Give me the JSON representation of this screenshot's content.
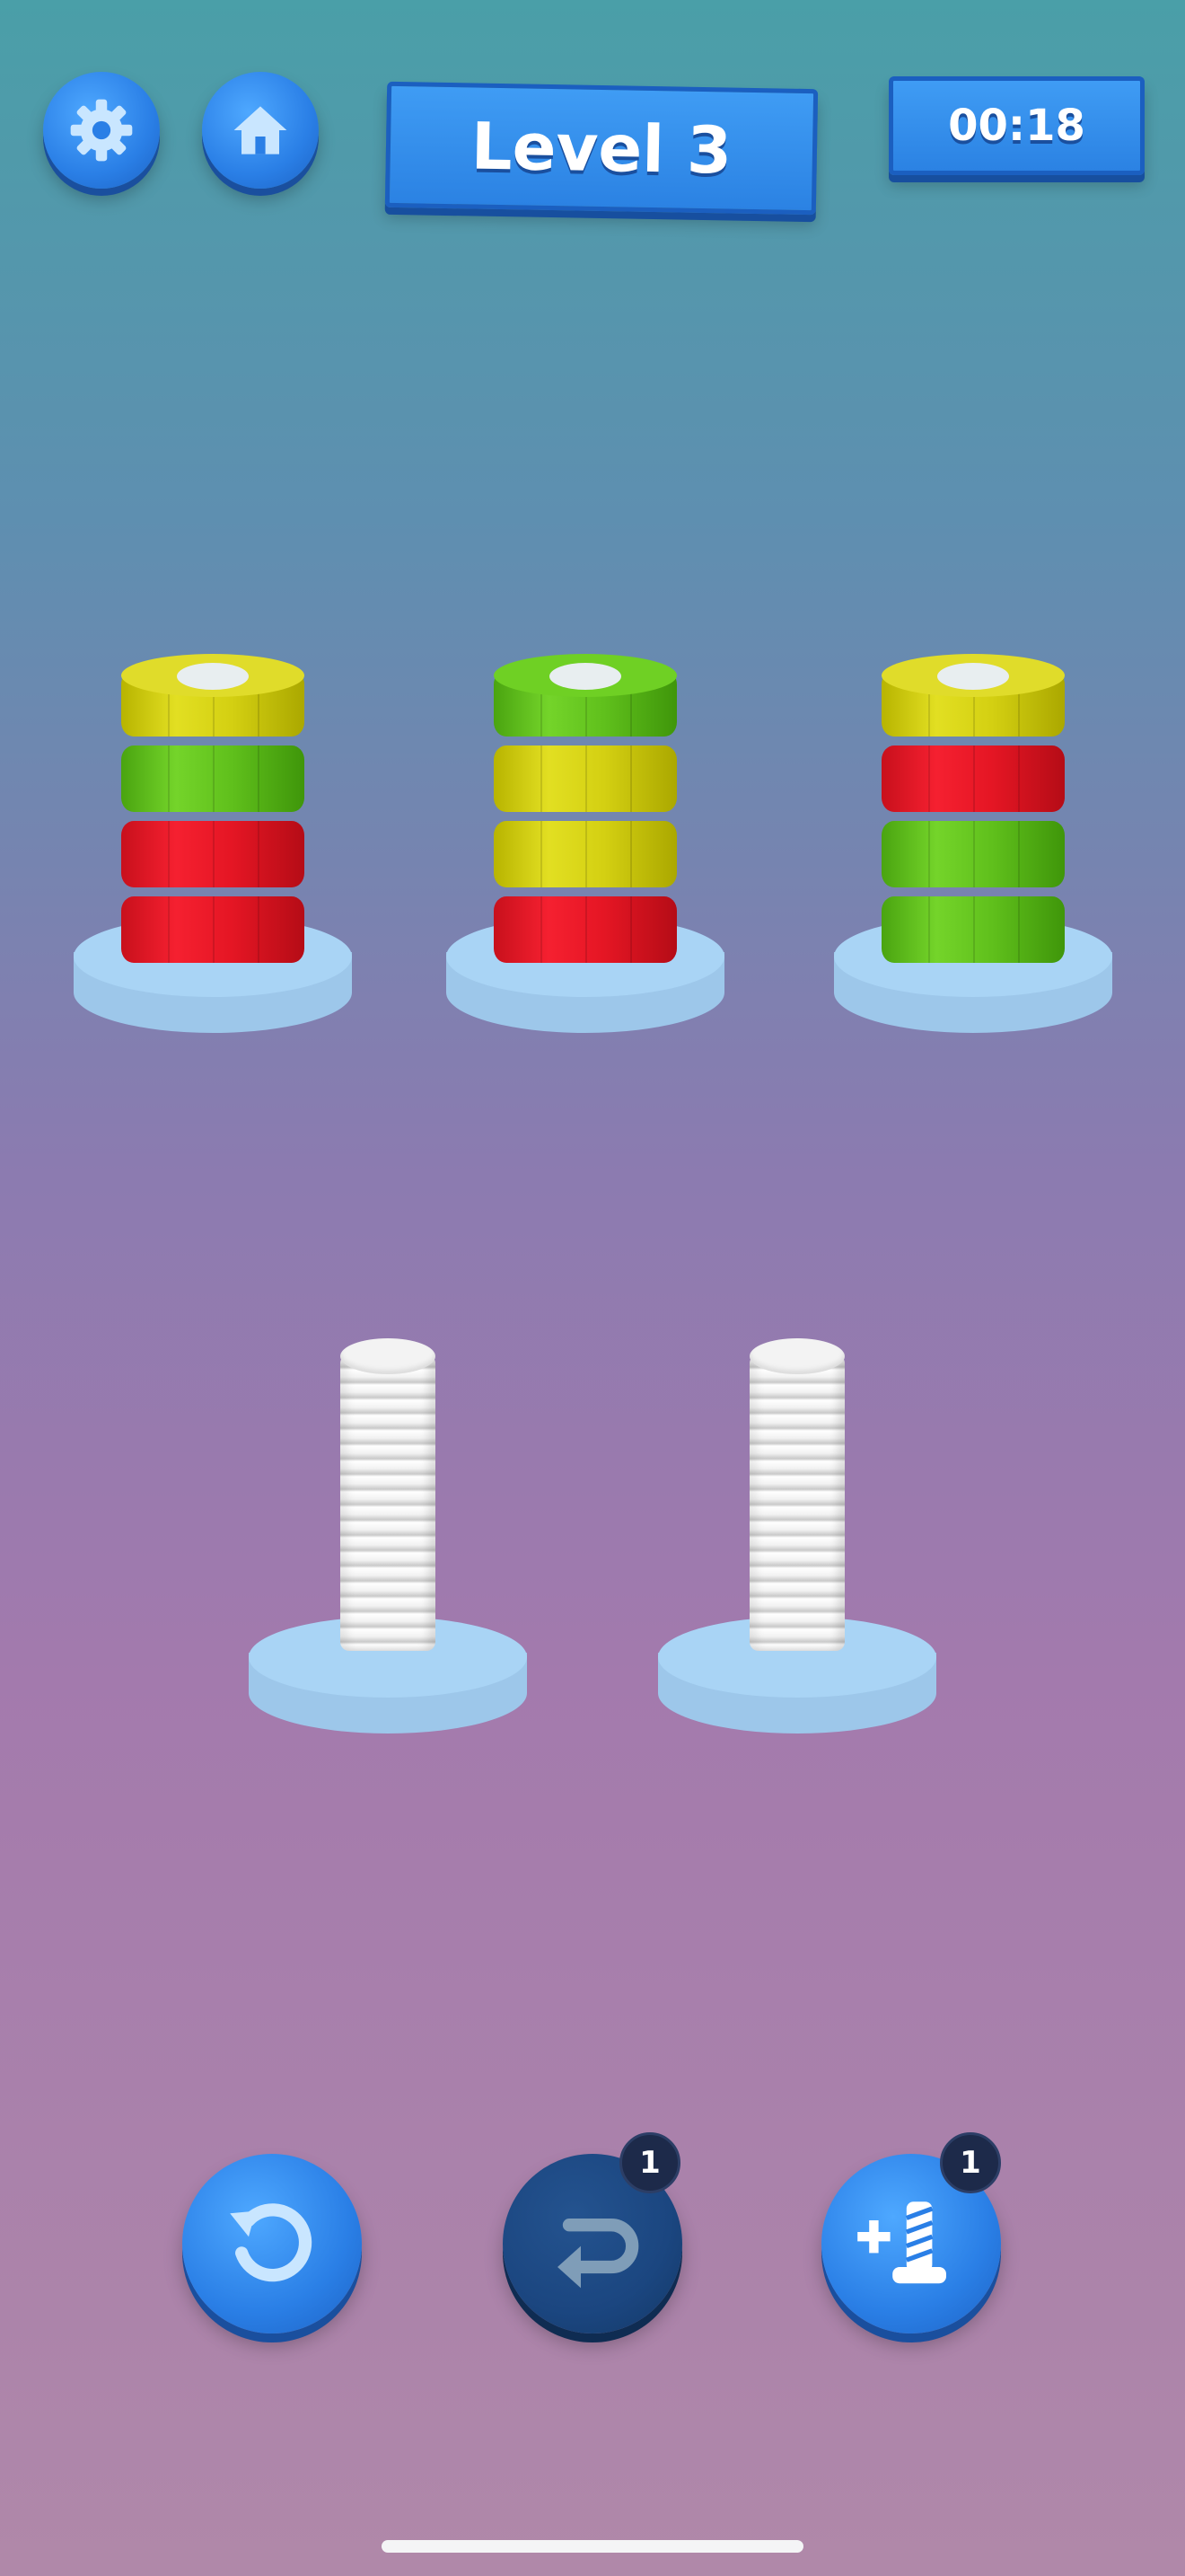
{
  "header": {
    "settings_icon": "gear-icon",
    "home_icon": "home-icon",
    "level_label": "Level 3",
    "timer": "00:18"
  },
  "board": {
    "nut_colors": {
      "yellow": "#e0dc2a",
      "green": "#6fd024",
      "red": "#f01e2c"
    },
    "pegs": [
      {
        "nuts_top_to_bottom": [
          "yellow",
          "green",
          "red",
          "red"
        ]
      },
      {
        "nuts_top_to_bottom": [
          "green",
          "yellow",
          "yellow",
          "red"
        ]
      },
      {
        "nuts_top_to_bottom": [
          "yellow",
          "red",
          "green",
          "green"
        ]
      },
      {
        "nuts_top_to_bottom": []
      },
      {
        "nuts_top_to_bottom": []
      }
    ]
  },
  "controls": {
    "restart": {
      "icon": "restart-icon"
    },
    "undo": {
      "icon": "undo-icon",
      "count": "1"
    },
    "add_screw": {
      "icon": "add-screw-icon",
      "count": "1"
    }
  },
  "colors": {
    "button_blue": "#2a7fe6",
    "button_dark": "#1b4680",
    "base": "#a9d4f5"
  }
}
